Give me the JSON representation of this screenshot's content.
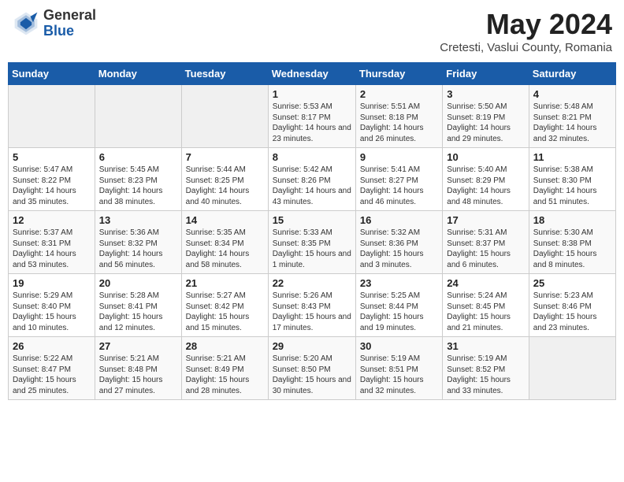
{
  "header": {
    "logo_general": "General",
    "logo_blue": "Blue",
    "month_title": "May 2024",
    "location": "Cretesti, Vaslui County, Romania"
  },
  "weekdays": [
    "Sunday",
    "Monday",
    "Tuesday",
    "Wednesday",
    "Thursday",
    "Friday",
    "Saturday"
  ],
  "weeks": [
    [
      {
        "day": "",
        "info": ""
      },
      {
        "day": "",
        "info": ""
      },
      {
        "day": "",
        "info": ""
      },
      {
        "day": "1",
        "info": "Sunrise: 5:53 AM\nSunset: 8:17 PM\nDaylight: 14 hours and 23 minutes."
      },
      {
        "day": "2",
        "info": "Sunrise: 5:51 AM\nSunset: 8:18 PM\nDaylight: 14 hours and 26 minutes."
      },
      {
        "day": "3",
        "info": "Sunrise: 5:50 AM\nSunset: 8:19 PM\nDaylight: 14 hours and 29 minutes."
      },
      {
        "day": "4",
        "info": "Sunrise: 5:48 AM\nSunset: 8:21 PM\nDaylight: 14 hours and 32 minutes."
      }
    ],
    [
      {
        "day": "5",
        "info": "Sunrise: 5:47 AM\nSunset: 8:22 PM\nDaylight: 14 hours and 35 minutes."
      },
      {
        "day": "6",
        "info": "Sunrise: 5:45 AM\nSunset: 8:23 PM\nDaylight: 14 hours and 38 minutes."
      },
      {
        "day": "7",
        "info": "Sunrise: 5:44 AM\nSunset: 8:25 PM\nDaylight: 14 hours and 40 minutes."
      },
      {
        "day": "8",
        "info": "Sunrise: 5:42 AM\nSunset: 8:26 PM\nDaylight: 14 hours and 43 minutes."
      },
      {
        "day": "9",
        "info": "Sunrise: 5:41 AM\nSunset: 8:27 PM\nDaylight: 14 hours and 46 minutes."
      },
      {
        "day": "10",
        "info": "Sunrise: 5:40 AM\nSunset: 8:29 PM\nDaylight: 14 hours and 48 minutes."
      },
      {
        "day": "11",
        "info": "Sunrise: 5:38 AM\nSunset: 8:30 PM\nDaylight: 14 hours and 51 minutes."
      }
    ],
    [
      {
        "day": "12",
        "info": "Sunrise: 5:37 AM\nSunset: 8:31 PM\nDaylight: 14 hours and 53 minutes."
      },
      {
        "day": "13",
        "info": "Sunrise: 5:36 AM\nSunset: 8:32 PM\nDaylight: 14 hours and 56 minutes."
      },
      {
        "day": "14",
        "info": "Sunrise: 5:35 AM\nSunset: 8:34 PM\nDaylight: 14 hours and 58 minutes."
      },
      {
        "day": "15",
        "info": "Sunrise: 5:33 AM\nSunset: 8:35 PM\nDaylight: 15 hours and 1 minute."
      },
      {
        "day": "16",
        "info": "Sunrise: 5:32 AM\nSunset: 8:36 PM\nDaylight: 15 hours and 3 minutes."
      },
      {
        "day": "17",
        "info": "Sunrise: 5:31 AM\nSunset: 8:37 PM\nDaylight: 15 hours and 6 minutes."
      },
      {
        "day": "18",
        "info": "Sunrise: 5:30 AM\nSunset: 8:38 PM\nDaylight: 15 hours and 8 minutes."
      }
    ],
    [
      {
        "day": "19",
        "info": "Sunrise: 5:29 AM\nSunset: 8:40 PM\nDaylight: 15 hours and 10 minutes."
      },
      {
        "day": "20",
        "info": "Sunrise: 5:28 AM\nSunset: 8:41 PM\nDaylight: 15 hours and 12 minutes."
      },
      {
        "day": "21",
        "info": "Sunrise: 5:27 AM\nSunset: 8:42 PM\nDaylight: 15 hours and 15 minutes."
      },
      {
        "day": "22",
        "info": "Sunrise: 5:26 AM\nSunset: 8:43 PM\nDaylight: 15 hours and 17 minutes."
      },
      {
        "day": "23",
        "info": "Sunrise: 5:25 AM\nSunset: 8:44 PM\nDaylight: 15 hours and 19 minutes."
      },
      {
        "day": "24",
        "info": "Sunrise: 5:24 AM\nSunset: 8:45 PM\nDaylight: 15 hours and 21 minutes."
      },
      {
        "day": "25",
        "info": "Sunrise: 5:23 AM\nSunset: 8:46 PM\nDaylight: 15 hours and 23 minutes."
      }
    ],
    [
      {
        "day": "26",
        "info": "Sunrise: 5:22 AM\nSunset: 8:47 PM\nDaylight: 15 hours and 25 minutes."
      },
      {
        "day": "27",
        "info": "Sunrise: 5:21 AM\nSunset: 8:48 PM\nDaylight: 15 hours and 27 minutes."
      },
      {
        "day": "28",
        "info": "Sunrise: 5:21 AM\nSunset: 8:49 PM\nDaylight: 15 hours and 28 minutes."
      },
      {
        "day": "29",
        "info": "Sunrise: 5:20 AM\nSunset: 8:50 PM\nDaylight: 15 hours and 30 minutes."
      },
      {
        "day": "30",
        "info": "Sunrise: 5:19 AM\nSunset: 8:51 PM\nDaylight: 15 hours and 32 minutes."
      },
      {
        "day": "31",
        "info": "Sunrise: 5:19 AM\nSunset: 8:52 PM\nDaylight: 15 hours and 33 minutes."
      },
      {
        "day": "",
        "info": ""
      }
    ]
  ]
}
